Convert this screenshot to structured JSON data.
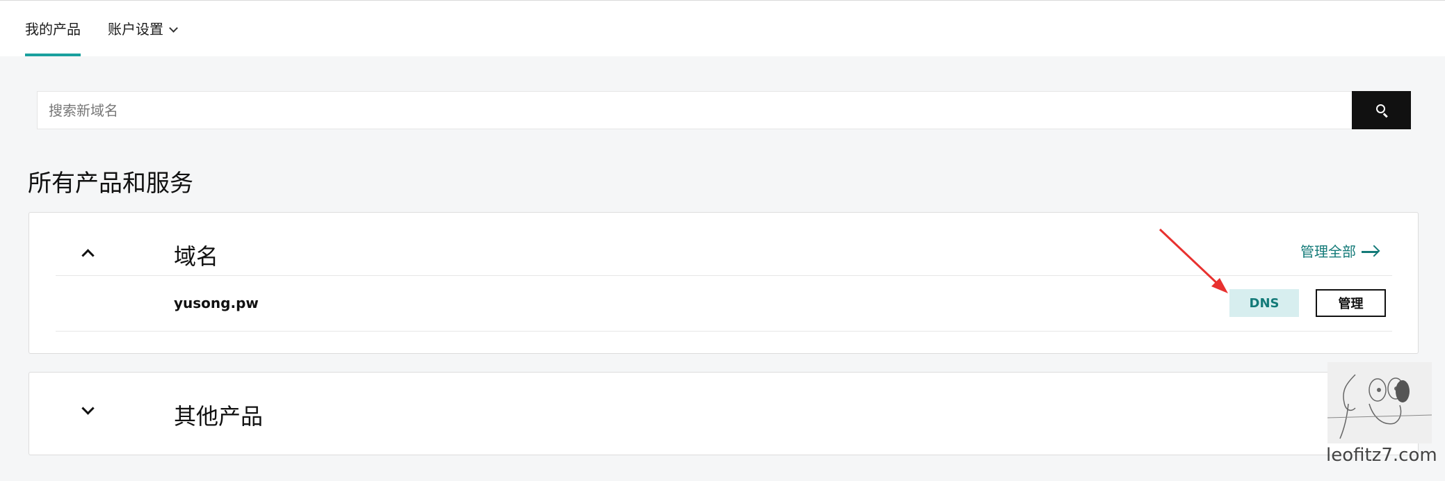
{
  "nav": {
    "tabs": [
      {
        "label": "我的产品",
        "active": true
      },
      {
        "label": "账户设置",
        "dropdown": true
      }
    ]
  },
  "search": {
    "placeholder": "搜索新域名",
    "button_icon": "search-icon"
  },
  "section": {
    "title": "所有产品和服务"
  },
  "groups": [
    {
      "title": "域名",
      "expanded": true,
      "manage_all_label": "管理全部",
      "items": [
        {
          "name": "yusong.pw",
          "dns_label": "DNS",
          "manage_label": "管理"
        }
      ]
    },
    {
      "title": "其他产品",
      "expanded": false
    }
  ],
  "watermark": {
    "text": "leofitz7.com"
  },
  "colors": {
    "accent": "#1aa09e",
    "link": "#137a78",
    "dns_bg": "#d7eeef",
    "annotation": "#e8312f"
  }
}
